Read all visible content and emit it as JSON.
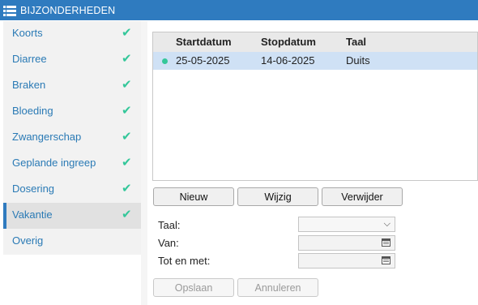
{
  "window": {
    "title": "BIJZONDERHEDEN",
    "title_icon": "list-icon"
  },
  "sidebar": {
    "items": [
      {
        "label": "Koorts",
        "checked": true
      },
      {
        "label": "Diarree",
        "checked": true
      },
      {
        "label": "Braken",
        "checked": true
      },
      {
        "label": "Bloeding",
        "checked": true
      },
      {
        "label": "Zwangerschap",
        "checked": true
      },
      {
        "label": "Geplande ingreep",
        "checked": true
      },
      {
        "label": "Dosering",
        "checked": true
      },
      {
        "label": "Vakantie",
        "checked": true,
        "active": true
      },
      {
        "label": "Overig",
        "checked": false
      }
    ],
    "check_glyph": "✔"
  },
  "table": {
    "columns": [
      "Startdatum",
      "Stopdatum",
      "Taal"
    ],
    "rows": [
      {
        "start": "25-05-2025",
        "stop": "14-06-2025",
        "taal": "Duits",
        "selected": true
      }
    ]
  },
  "actions": {
    "new": "Nieuw",
    "edit": "Wijzig",
    "delete": "Verwijder"
  },
  "form": {
    "taal_label": "Taal:",
    "taal_value": "",
    "van_label": "Van:",
    "van_value": "",
    "tot_label": "Tot en met:",
    "tot_value": ""
  },
  "footer": {
    "save": "Opslaan",
    "cancel": "Annuleren"
  },
  "colors": {
    "accent": "#2f7bbf",
    "check": "#34c79a",
    "selected_row": "#cfe1f5"
  }
}
